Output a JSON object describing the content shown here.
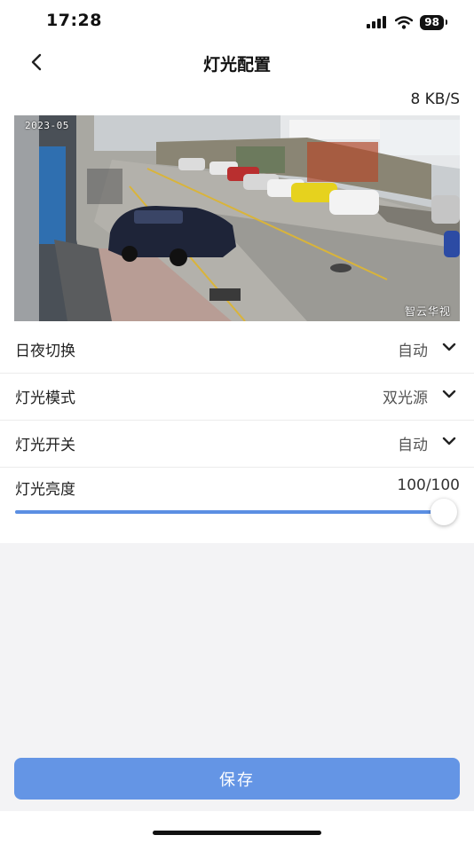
{
  "status_bar": {
    "time": "17:28",
    "battery": "98"
  },
  "nav": {
    "title": "灯光配置",
    "back_icon": "chevron-left-icon"
  },
  "stream": {
    "speed": "8 KB/S",
    "osd_datetime": "2023-05 ",
    "watermark": "智云华视"
  },
  "settings": [
    {
      "label": "日夜切换",
      "value": "自动"
    },
    {
      "label": "灯光模式",
      "value": "双光源"
    },
    {
      "label": "灯光开关",
      "value": "自动"
    }
  ],
  "brightness": {
    "label": "灯光亮度",
    "value_text": "100/100",
    "level": 100,
    "max": 100
  },
  "footer": {
    "save_label": "保存"
  },
  "colors": {
    "accent": "#5b8fe3",
    "button": "#6495e5",
    "background_gray": "#f3f3f5"
  }
}
